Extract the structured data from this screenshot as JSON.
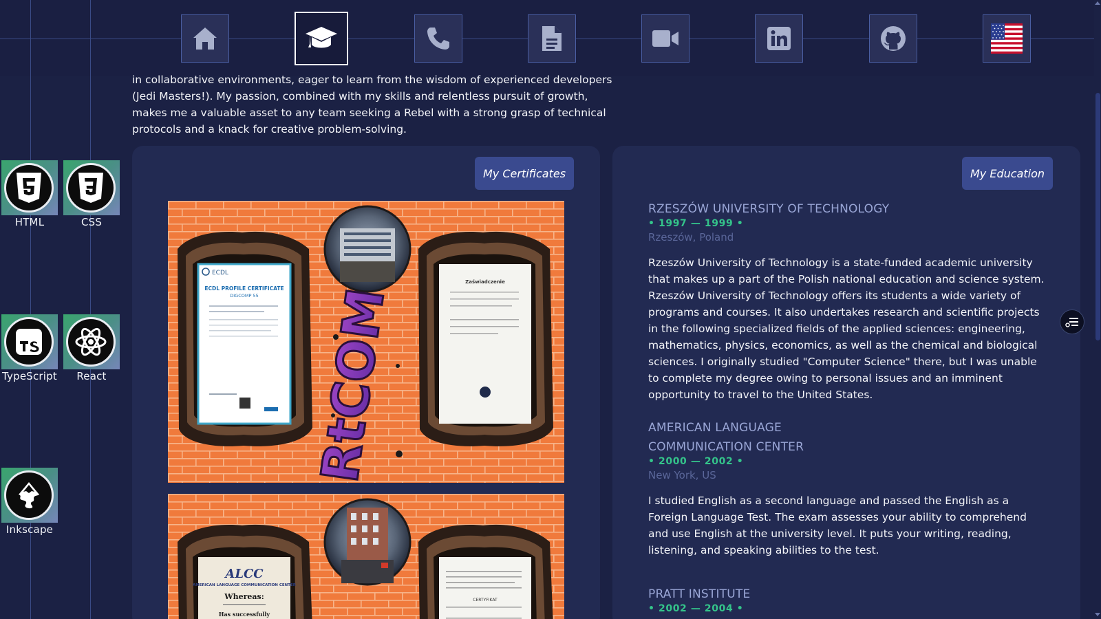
{
  "nav": {
    "items": [
      {
        "icon": "home-icon",
        "active": false
      },
      {
        "icon": "graduation-cap-icon",
        "active": true
      },
      {
        "icon": "phone-icon",
        "active": false
      },
      {
        "icon": "document-icon",
        "active": false
      },
      {
        "icon": "video-camera-icon",
        "active": false
      },
      {
        "icon": "linkedin-icon",
        "active": false
      },
      {
        "icon": "github-icon",
        "active": false
      },
      {
        "icon": "us-flag-icon",
        "active": false
      }
    ]
  },
  "skills": {
    "html": "HTML",
    "css": "CSS",
    "typescript": "TypeScript",
    "react": "React",
    "inkscape": "Inkscape"
  },
  "intro": {
    "text": "in collaborative environments, eager to learn from the wisdom of experienced developers (Jedi Masters!). My passion, combined with my skills and relentless pursuit of growth, makes me a valuable asset to any team seeking a Rebel with a strong grasp of technical protocols and a knack for creative problem-solving."
  },
  "certificates": {
    "title": "My Certificates",
    "cert1": {
      "left_brand": "ECDL",
      "left_title": "ECDL PROFILE CERTIFICATE",
      "left_subtitle": "DIGCOMP 55",
      "right_title": "Zaświadczenie",
      "graffiti": "ARtCOM"
    },
    "cert2": {
      "left_brand": "ALCC",
      "left_title": "AMERICAN LANGUAGE COMMUNICATION CENTER",
      "left_whereas": "Whereas:",
      "left_success": "Has successfully",
      "right_title": "CERTYFIKAT"
    }
  },
  "education": {
    "title": "My Education",
    "entries": [
      {
        "name": "RZESZÓW UNIVERSITY OF TECHNOLOGY",
        "years": "• 1997 — 1999 •",
        "location": "Rzeszów, Poland",
        "description": "Rzeszów University of Technology is a state-funded academic university that makes up a part of the Polish national education and science system. Rzeszów University of Technology offers its students a wide variety of programs and courses. It also undertakes research and scientific projects in the following specialized fields of the applied sciences: engineering, mathematics, physics, economics, as well as the chemical and biological sciences. I originally studied \"Computer Science\" there, but I was unable to complete my degree owing to personal issues and an imminent opportunity to travel to the United States."
      },
      {
        "name_line1": "AMERICAN LANGUAGE",
        "name_line2": "COMMUNICATION CENTER",
        "years": "• 2000 — 2002 •",
        "location": "New York, US",
        "description": "I studied English as a second language and passed the English as a Foreign Language Test. The exam assesses your ability to comprehend and use English at the university level. It puts your writing, reading, listening, and speaking abilities to the test."
      },
      {
        "name": "PRATT INSTITUTE",
        "years": "• 2002 — 2004 •"
      }
    ]
  },
  "colors": {
    "background": "#1b2144",
    "card": "#222a52",
    "accent_green": "#34c48a",
    "school_name": "#9aa6d6",
    "pill": "#3a4a8f"
  }
}
